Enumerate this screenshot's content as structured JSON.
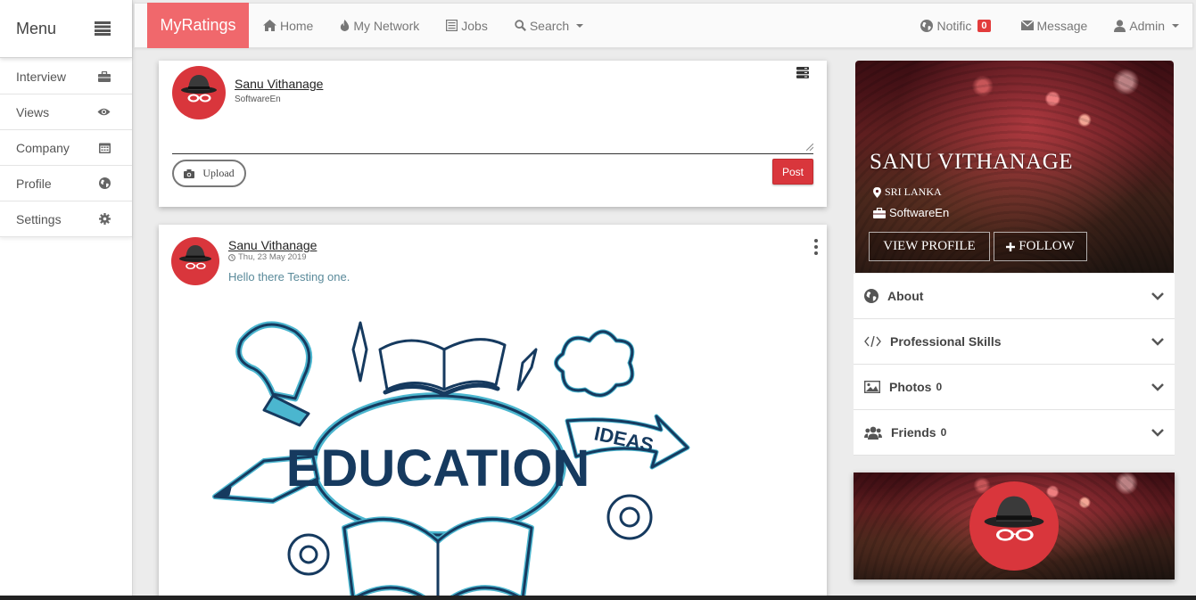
{
  "sidebar": {
    "title": "Menu",
    "items": [
      {
        "label": "Interview",
        "icon": "briefcase-icon"
      },
      {
        "label": "Views",
        "icon": "eye-icon"
      },
      {
        "label": "Company",
        "icon": "calendar-icon"
      },
      {
        "label": "Profile",
        "icon": "globe-icon"
      },
      {
        "label": "Settings",
        "icon": "gear-icon"
      }
    ]
  },
  "nav": {
    "brand": "MyRatings",
    "home": "Home",
    "network": "My Network",
    "jobs": "Jobs",
    "search": "Search",
    "notifications": "Notific",
    "notification_count": "0",
    "message": "Message",
    "user": "Admin"
  },
  "composer": {
    "user_name": "Sanu Vithanage",
    "user_role": "SoftwareEn",
    "upload_label": "Upload",
    "post_label": "Post"
  },
  "post": {
    "author": "Sanu Vithanage",
    "date": "Thu, 23 May 2019",
    "text": "Hello there Testing one.",
    "image_words": [
      "EDUCATION",
      "IDEAS"
    ]
  },
  "profile": {
    "name": "SANU VITHANAGE",
    "location": "SRI LANKA",
    "role": "SoftwareEn",
    "view_profile_label": "VIEW PROFILE",
    "follow_label": "FOLLOW"
  },
  "accordion": [
    {
      "label": "About",
      "icon": "globe-icon",
      "count": ""
    },
    {
      "label": "Professional Skills",
      "icon": "code-icon",
      "count": ""
    },
    {
      "label": "Photos",
      "icon": "image-icon",
      "count": "0"
    },
    {
      "label": "Friends",
      "icon": "users-icon",
      "count": "0"
    }
  ],
  "colors": {
    "brand": "#f0686c",
    "accent_red": "#d9363c",
    "link_text": "#5a8a9a",
    "illustration_teal": "#4bb6cf",
    "illustration_navy": "#163a5f"
  }
}
